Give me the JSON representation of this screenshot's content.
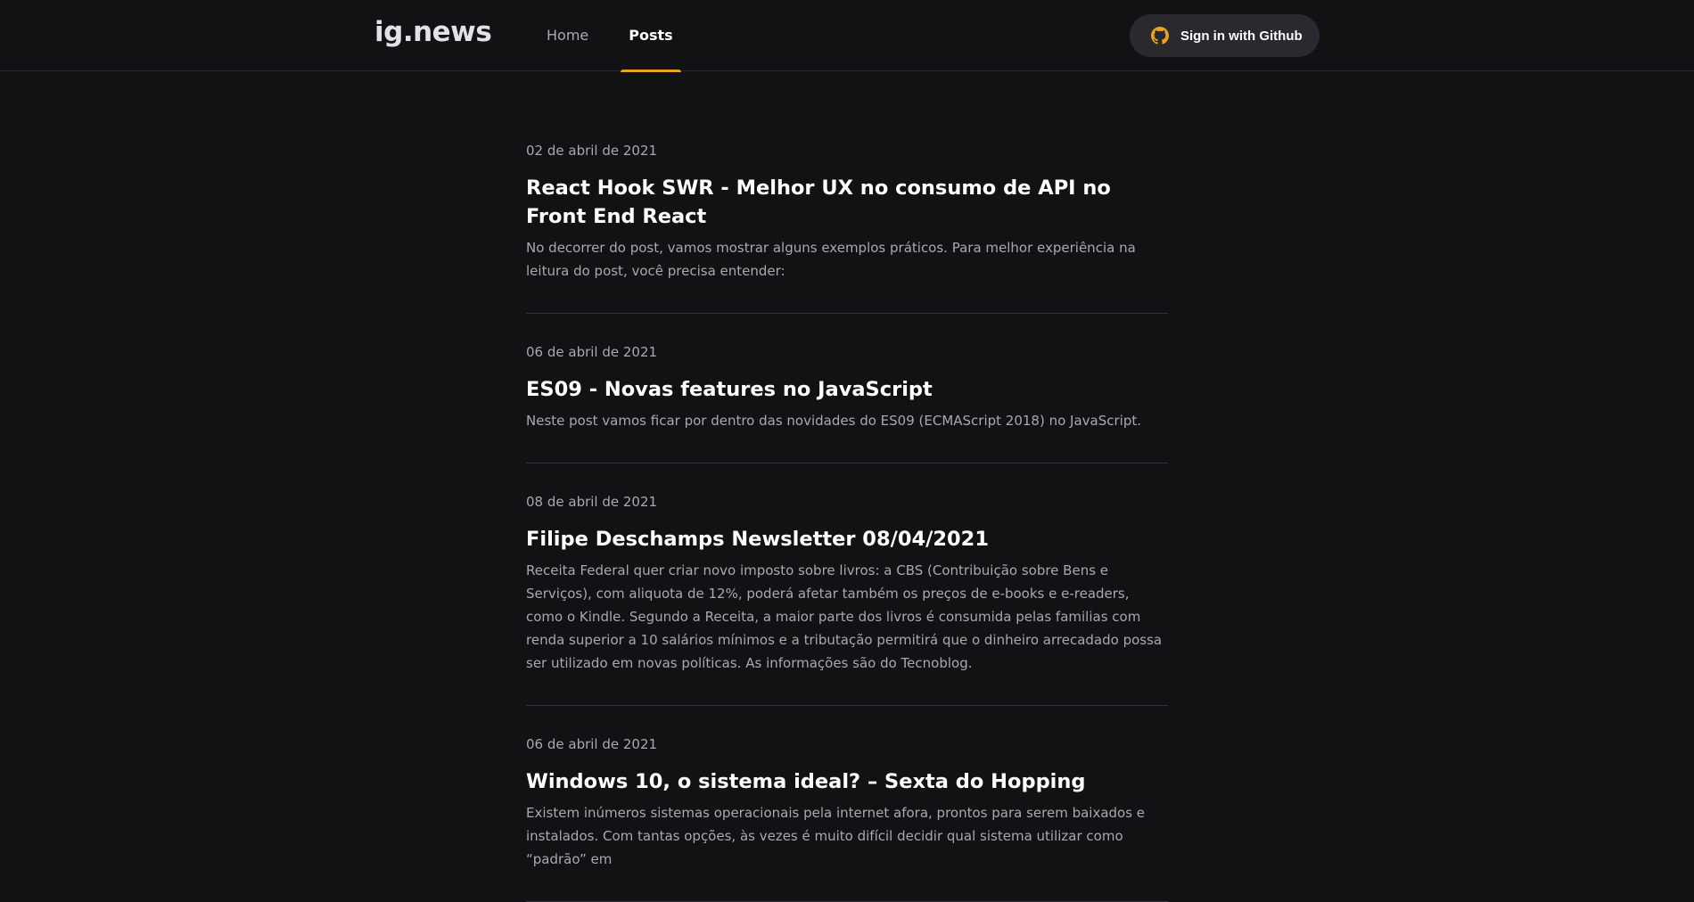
{
  "header": {
    "logo": "ig.news",
    "nav": [
      {
        "label": "Home",
        "active": false
      },
      {
        "label": "Posts",
        "active": true
      }
    ],
    "signin_label": "Sign in with Github",
    "signin_icon": "github-icon"
  },
  "colors": {
    "background": "#121214",
    "accent": "#eba417",
    "button_bg": "#29292e",
    "text_muted": "#a8a8b3",
    "divider": "#323238"
  },
  "posts": [
    {
      "date": "02 de abril de 2021",
      "title": "React Hook SWR - Melhor UX no consumo de API no Front End React",
      "excerpt": "No decorrer do post, vamos mostrar alguns exemplos práticos. Para melhor experiência na leitura do post, você precisa entender:"
    },
    {
      "date": "06 de abril de 2021",
      "title": "ES09 - Novas features no JavaScript",
      "excerpt": "Neste post vamos ficar por dentro das novidades do ES09 (ECMAScript 2018) no JavaScript."
    },
    {
      "date": "08 de abril de 2021",
      "title": "Filipe Deschamps Newsletter 08/04/2021",
      "excerpt": "Receita Federal quer criar novo imposto sobre livros: a CBS (Contribuição sobre Bens e Serviços), com aliquota de 12%, poderá afetar também os preços de e-books e e-readers, como o Kindle. Segundo a Receita, a maior parte dos livros é consumida pelas familias com renda superior a 10 salários mínimos e a tributação permitirá que o dinheiro arrecadado possa ser utilizado em novas políticas. As informações são do Tecnoblog."
    },
    {
      "date": "06 de abril de 2021",
      "title": "Windows 10, o sistema ideal? – Sexta do Hopping",
      "excerpt": "Existem inúmeros sistemas operacionais pela internet afora, prontos para serem baixados e instalados. Com tantas opções, às vezes é muito difícil decidir qual sistema utilizar como “padrão” em"
    }
  ]
}
